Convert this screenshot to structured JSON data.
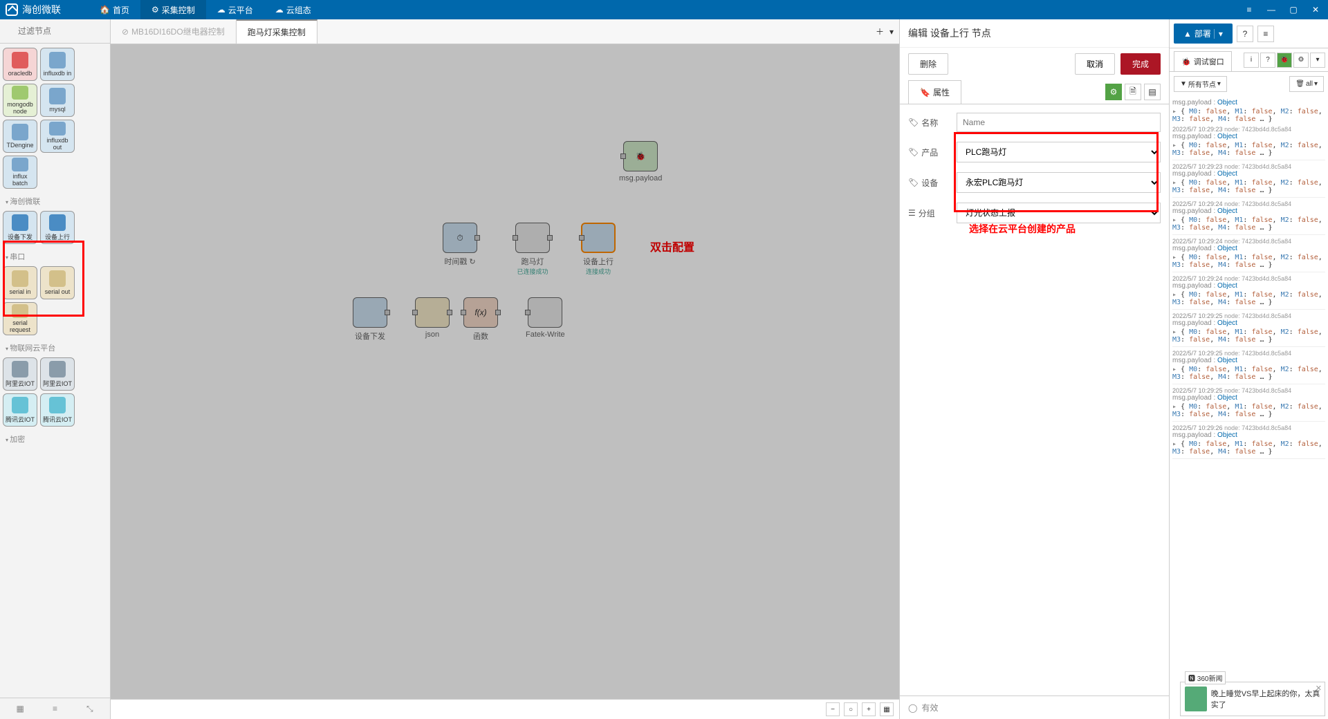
{
  "app": {
    "title": "海创微联"
  },
  "nav": [
    {
      "label": "首页",
      "icon": "🏠"
    },
    {
      "label": "采集控制",
      "icon": "⚙"
    },
    {
      "label": "云平台",
      "icon": "☁"
    },
    {
      "label": "云组态",
      "icon": "☁"
    }
  ],
  "search": {
    "placeholder": "过滤节点"
  },
  "palette": {
    "rows": [
      [
        {
          "label": "oracledb",
          "color": "#e05c5c"
        },
        {
          "label": "influxdb in",
          "color": "#7aa6cc"
        }
      ],
      [
        {
          "label": "mongodb node",
          "color": "#9fc96f"
        },
        {
          "label": "mysql",
          "color": "#7aa6cc"
        }
      ],
      [
        {
          "label": "TDengine",
          "color": "#7aa6cc"
        },
        {
          "label": "influxdb out",
          "color": "#7aa6cc"
        }
      ],
      [
        {
          "label": "influx batch",
          "color": "#7aa6cc"
        }
      ]
    ],
    "cat1": "海创微联",
    "hc_rows": [
      [
        {
          "label": "设备下发",
          "color": "#7aa6cc"
        },
        {
          "label": "设备上行",
          "color": "#7aa6cc"
        }
      ]
    ],
    "cat2": "串口",
    "serial_rows": [
      [
        {
          "label": "serial in",
          "color": "#d3c08a"
        },
        {
          "label": "serial out",
          "color": "#d3c08a"
        }
      ],
      [
        {
          "label": "serial request",
          "color": "#d3c08a"
        }
      ]
    ],
    "cat3": "物联网云平台",
    "iot_rows": [
      [
        {
          "label": "阿里云IOT",
          "color": "#8a9caa"
        },
        {
          "label": "阿里云IOT",
          "color": "#8a9caa"
        }
      ],
      [
        {
          "label": "腾讯云IOT",
          "color": "#66c2d6"
        },
        {
          "label": "腾讯云IOT",
          "color": "#66c2d6"
        }
      ]
    ],
    "cat4": "加密"
  },
  "tabs": {
    "disabled": "MB16DI16DO继电器控制",
    "active": "跑马灯采集控制"
  },
  "canvas": {
    "nodes": {
      "timer": {
        "label": "时间戳 ↻"
      },
      "run": {
        "label": "跑马灯",
        "status": "已连接成功"
      },
      "uplink": {
        "label": "设备上行",
        "status": "连接成功"
      },
      "msg": {
        "label": "msg.payload"
      },
      "downlink": {
        "label": "设备下发"
      },
      "json": {
        "label": "json"
      },
      "fx": {
        "label": "函数"
      },
      "fatek": {
        "label": "Fatek-Write"
      }
    },
    "anno1": "双击配置",
    "anno2": "选择在云平台创建的产品"
  },
  "edit": {
    "title": "编辑 设备上行 节点",
    "delete": "删除",
    "cancel": "取消",
    "done": "完成",
    "tab_prop": "属性",
    "name_label": "名称",
    "name_placeholder": "Name",
    "product_label": "产品",
    "product_value": "PLC跑马灯",
    "device_label": "设备",
    "device_value": "永宏PLC跑马灯",
    "group_label": "分组",
    "group_value": "灯光状态上报",
    "footer": "有效"
  },
  "deploy": {
    "label": "部署"
  },
  "debug": {
    "title": "调试窗口",
    "filter_nodes": "所有节点",
    "filter_all": "all",
    "entries": [
      {
        "ts": "2022/5/7 10:29:23",
        "node": "node: 7423bd4d.8c5a84"
      },
      {
        "ts": "2022/5/7 10:29:23",
        "node": "node: 7423bd4d.8c5a84"
      },
      {
        "ts": "2022/5/7 10:29:24",
        "node": "node: 7423bd4d.8c5a84"
      },
      {
        "ts": "2022/5/7 10:29:24",
        "node": "node: 7423bd4d.8c5a84"
      },
      {
        "ts": "2022/5/7 10:29:24",
        "node": "node: 7423bd4d.8c5a84"
      },
      {
        "ts": "2022/5/7 10:29:25",
        "node": "node: 7423bd4d.8c5a84"
      },
      {
        "ts": "2022/5/7 10:29:25",
        "node": "node: 7423bd4d.8c5a84"
      },
      {
        "ts": "2022/5/7 10:29:25",
        "node": "node: 7423bd4d.8c5a84"
      },
      {
        "ts": "2022/5/7 10:29:26",
        "node": "node: 7423bd4d.8c5a84"
      }
    ],
    "msg_path": "msg.payload",
    "msg_type": "Object",
    "body_html": "{ <span class='key'>M0</span>: <span class='val'>false</span>, <span class='key'>M1</span>: <span class='val'>false</span>, <span class='key'>M2</span>: <span class='val'>false</span>, <span class='key'>M3</span>: <span class='val'>false</span>, <span class='key'>M4</span>: <span class='val'>false</span> … }"
  },
  "news": {
    "source": "360新闻",
    "title": "晚上睡觉VS早上起床的你，太真实了"
  }
}
